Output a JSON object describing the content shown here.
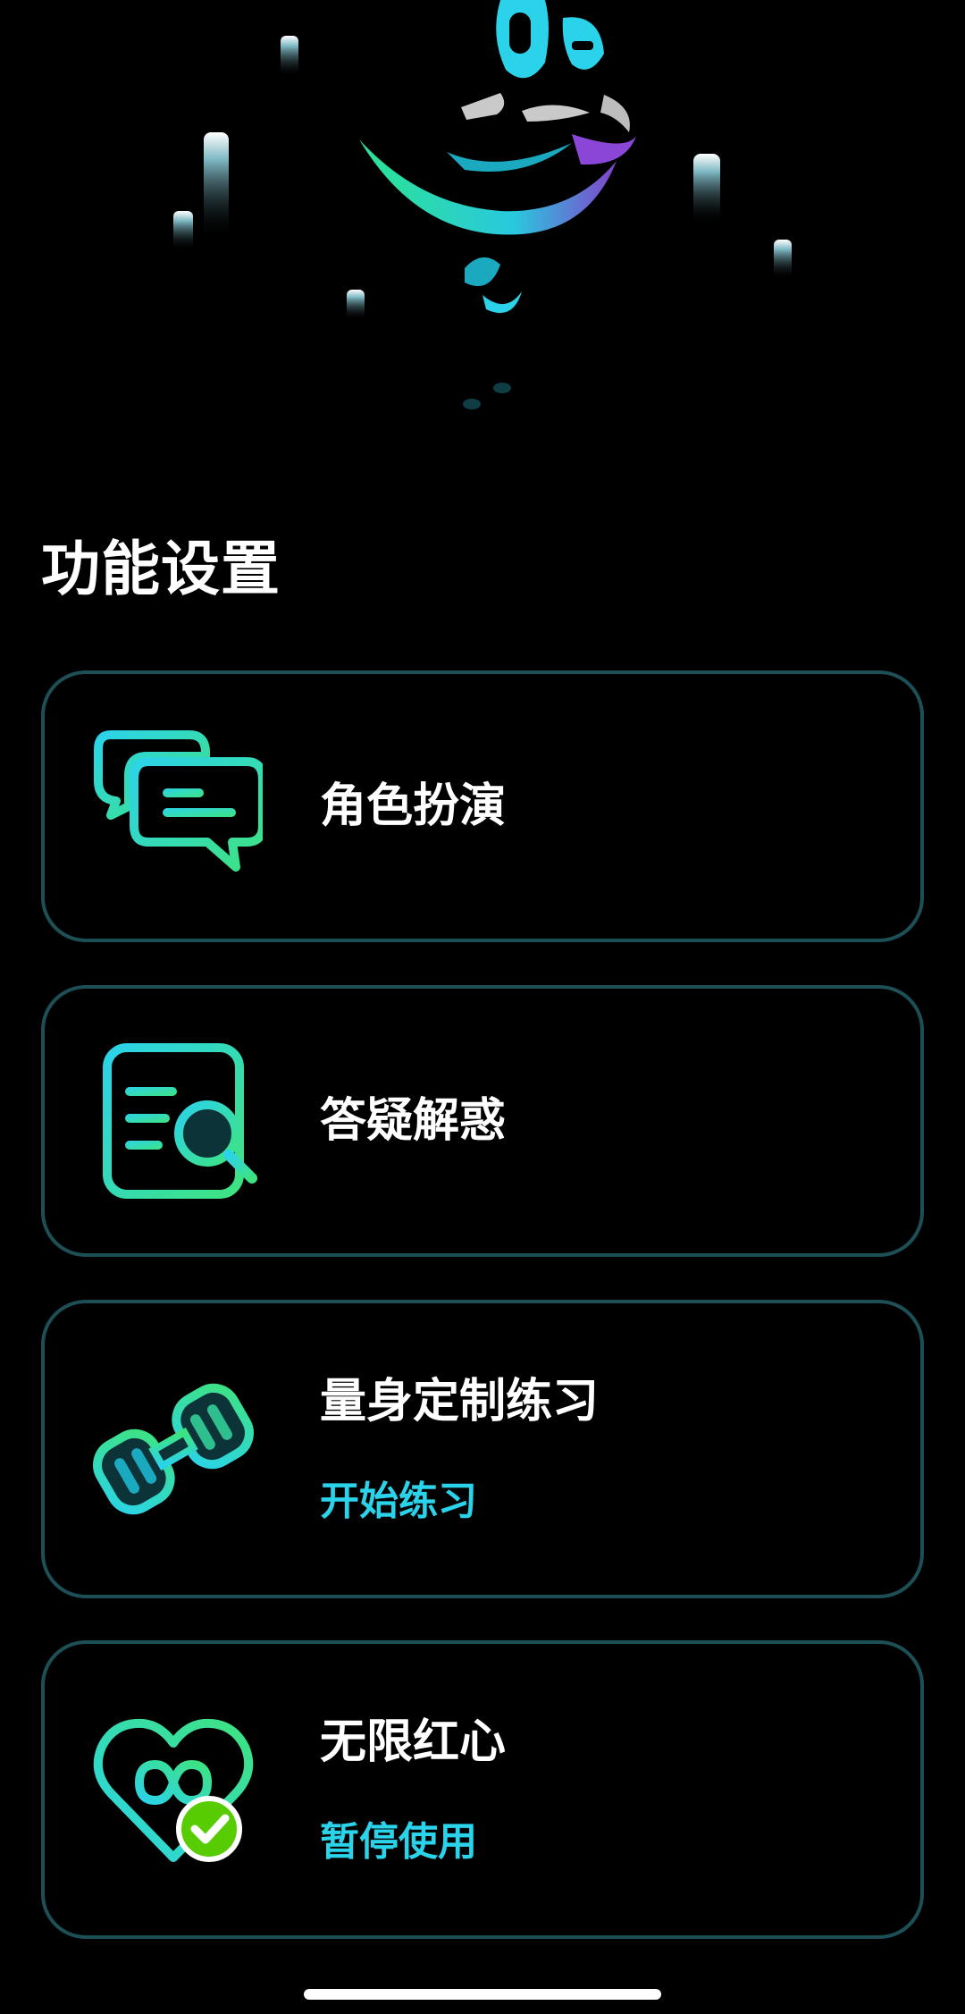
{
  "section_title": "功能设置",
  "cards": [
    {
      "title": "角色扮演",
      "icon": "chat-bubbles-icon"
    },
    {
      "title": "答疑解惑",
      "icon": "document-search-icon"
    },
    {
      "title": "量身定制练习",
      "subtitle": "开始练习",
      "icon": "dumbbell-icon"
    },
    {
      "title": "无限红心",
      "subtitle": "暂停使用",
      "icon": "infinity-heart-icon"
    }
  ],
  "colors": {
    "background": "#000000",
    "card_border": "#1d4f57",
    "accent_cyan": "#2bd3ea",
    "accent_green": "#3ee37f",
    "check_green": "#58cc02"
  }
}
